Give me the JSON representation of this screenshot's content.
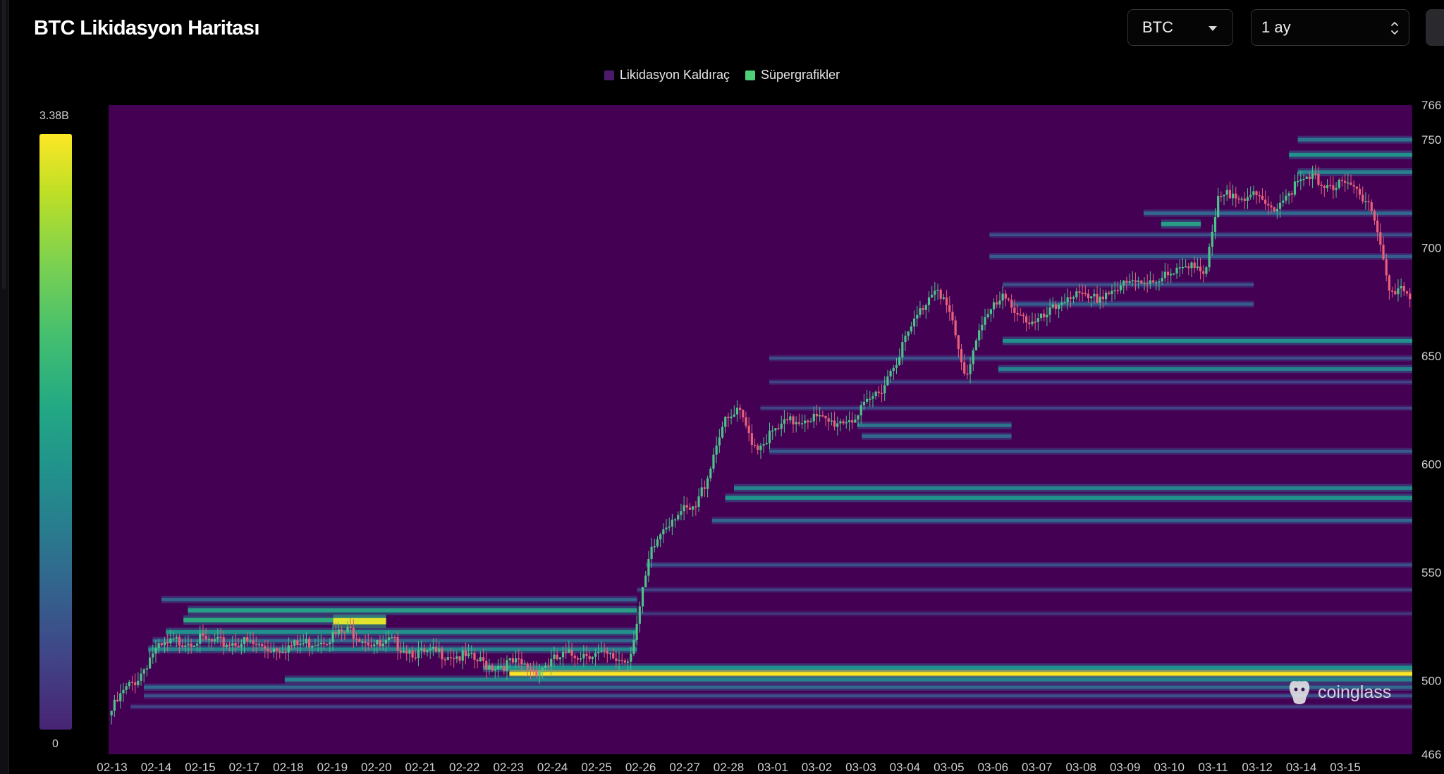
{
  "header": {
    "title": "BTC Likidasyon Haritası",
    "coin_select": "BTC",
    "period_select": "1 ay"
  },
  "legend": {
    "items": [
      {
        "label": "Likidasyon Kaldıraç",
        "color": "#4b1a6b"
      },
      {
        "label": "Süpergrafikler",
        "color": "#4fcf78"
      }
    ]
  },
  "colorbar": {
    "max_label": "3.38B",
    "min_label": "0"
  },
  "watermark": "coinglass",
  "colors": {
    "plot_background": "#440154",
    "candle_up": "#4cc38a",
    "candle_down": "#e8607a",
    "heat_low": "#31688e",
    "heat_mid": "#35b779",
    "heat_high": "#fde725"
  },
  "chart_data": {
    "type": "heatmap",
    "title": "BTC Likidasyon Haritası",
    "x_ticks": [
      "02-13",
      "02-14",
      "02-15",
      "02-17",
      "02-18",
      "02-19",
      "02-20",
      "02-21",
      "02-22",
      "02-23",
      "02-24",
      "02-25",
      "02-26",
      "02-27",
      "02-28",
      "03-01",
      "03-02",
      "03-03",
      "03-04",
      "03-05",
      "03-06",
      "03-07",
      "03-08",
      "03-09",
      "03-10",
      "03-11",
      "03-12",
      "03-14",
      "03-15"
    ],
    "x_start": 0,
    "x_end": 29.6,
    "y_ticks": [
      46600,
      50000,
      55000,
      60000,
      65000,
      70000,
      75000,
      76600
    ],
    "y_tick_labels": [
      "466",
      "500",
      "550",
      "600",
      "650",
      "700",
      "750",
      "766"
    ],
    "ylim": [
      46600,
      76600
    ],
    "colorbar_range": [
      0,
      3.38
    ],
    "colorbar_unit": "B",
    "price_series": {
      "x": [
        0,
        0.35,
        0.7,
        1.0,
        1.5,
        2,
        2.5,
        3,
        3.6,
        4.2,
        4.8,
        5.5,
        6.2,
        6.4,
        7.1,
        7.6,
        8.2,
        8.7,
        9.2,
        9.7,
        10.3,
        10.9,
        11.5,
        11.8,
        12.0,
        12.3,
        12.6,
        12.9,
        13.3,
        13.6,
        13.9,
        14.3,
        14.7,
        15.0,
        15.4,
        15.9,
        16.4,
        17,
        17.6,
        18.3,
        18.8,
        19.1,
        19.45,
        19.8,
        20.3,
        20.6,
        21.0,
        21.4,
        21.8,
        22.3,
        22.7,
        23.2,
        23.7,
        24.2,
        24.6,
        24.9,
        25.2,
        25.6,
        26.0,
        26.4,
        26.9,
        27.3,
        27.8,
        28.2,
        28.6,
        28.85,
        29.1,
        29.4,
        29.6
      ],
      "y": [
        48400,
        49500,
        50200,
        51300,
        51800,
        51900,
        51700,
        51800,
        51500,
        51600,
        51900,
        52300,
        51500,
        51800,
        51200,
        51300,
        51000,
        50700,
        50800,
        50500,
        51100,
        51300,
        51000,
        51000,
        52700,
        55800,
        57100,
        57800,
        57800,
        59500,
        61700,
        62400,
        60800,
        61300,
        61900,
        62200,
        61900,
        62200,
        63700,
        66600,
        68400,
        66900,
        63900,
        66600,
        67600,
        67200,
        66400,
        67000,
        67900,
        67500,
        68000,
        68300,
        68600,
        68700,
        69500,
        68700,
        72200,
        72600,
        72300,
        71800,
        72800,
        73200,
        72900,
        72800,
        72300,
        70500,
        67700,
        68100,
        67800
      ]
    },
    "liquidation_bands": [
      {
        "price": 50350,
        "x_from": 9.1,
        "x_to": 29.6,
        "intensity": 1.0
      },
      {
        "price": 50600,
        "x_from": 8.5,
        "x_to": 29.6,
        "intensity": 0.45
      },
      {
        "price": 50050,
        "x_from": 4.0,
        "x_to": 29.6,
        "intensity": 0.4
      },
      {
        "price": 49700,
        "x_from": 0.8,
        "x_to": 29.6,
        "intensity": 0.3
      },
      {
        "price": 49300,
        "x_from": 0.8,
        "x_to": 29.6,
        "intensity": 0.2
      },
      {
        "price": 48800,
        "x_from": 0.5,
        "x_to": 29.6,
        "intensity": 0.15
      },
      {
        "price": 51450,
        "x_from": 0.9,
        "x_to": 12.0,
        "intensity": 0.4
      },
      {
        "price": 51850,
        "x_from": 1.0,
        "x_to": 12.0,
        "intensity": 0.3
      },
      {
        "price": 52250,
        "x_from": 1.3,
        "x_to": 12.0,
        "intensity": 0.45
      },
      {
        "price": 52800,
        "x_from": 1.7,
        "x_to": 6.3,
        "intensity": 0.55
      },
      {
        "price": 52750,
        "x_from": 5.1,
        "x_to": 6.3,
        "intensity": 0.95
      },
      {
        "price": 53250,
        "x_from": 1.8,
        "x_to": 12.0,
        "intensity": 0.5
      },
      {
        "price": 53750,
        "x_from": 1.2,
        "x_to": 12.0,
        "intensity": 0.3
      },
      {
        "price": 53100,
        "x_from": 12.0,
        "x_to": 29.6,
        "intensity": 0.12
      },
      {
        "price": 54200,
        "x_from": 12.0,
        "x_to": 29.6,
        "intensity": 0.15
      },
      {
        "price": 55350,
        "x_from": 12.2,
        "x_to": 29.6,
        "intensity": 0.2
      },
      {
        "price": 57400,
        "x_from": 13.7,
        "x_to": 29.6,
        "intensity": 0.3
      },
      {
        "price": 58450,
        "x_from": 14.0,
        "x_to": 29.6,
        "intensity": 0.45
      },
      {
        "price": 58900,
        "x_from": 14.2,
        "x_to": 29.6,
        "intensity": 0.4
      },
      {
        "price": 60600,
        "x_from": 15.0,
        "x_to": 29.6,
        "intensity": 0.25
      },
      {
        "price": 61300,
        "x_from": 17.1,
        "x_to": 20.5,
        "intensity": 0.3
      },
      {
        "price": 61800,
        "x_from": 17.0,
        "x_to": 20.5,
        "intensity": 0.35
      },
      {
        "price": 62600,
        "x_from": 14.8,
        "x_to": 29.6,
        "intensity": 0.15
      },
      {
        "price": 63800,
        "x_from": 15.0,
        "x_to": 29.6,
        "intensity": 0.15
      },
      {
        "price": 64400,
        "x_from": 20.2,
        "x_to": 29.6,
        "intensity": 0.4
      },
      {
        "price": 64900,
        "x_from": 15.0,
        "x_to": 29.6,
        "intensity": 0.2
      },
      {
        "price": 65700,
        "x_from": 20.3,
        "x_to": 29.6,
        "intensity": 0.45
      },
      {
        "price": 67400,
        "x_from": 20.5,
        "x_to": 26.0,
        "intensity": 0.25
      },
      {
        "price": 68300,
        "x_from": 20.3,
        "x_to": 26.0,
        "intensity": 0.2
      },
      {
        "price": 69600,
        "x_from": 20.0,
        "x_to": 29.6,
        "intensity": 0.25
      },
      {
        "price": 70600,
        "x_from": 20.0,
        "x_to": 29.6,
        "intensity": 0.2
      },
      {
        "price": 71100,
        "x_from": 23.9,
        "x_to": 24.8,
        "intensity": 0.5
      },
      {
        "price": 71600,
        "x_from": 23.5,
        "x_to": 29.6,
        "intensity": 0.3
      },
      {
        "price": 73500,
        "x_from": 27.0,
        "x_to": 29.6,
        "intensity": 0.4
      },
      {
        "price": 74300,
        "x_from": 26.8,
        "x_to": 29.6,
        "intensity": 0.45
      },
      {
        "price": 75000,
        "x_from": 27.0,
        "x_to": 29.6,
        "intensity": 0.35
      }
    ]
  }
}
